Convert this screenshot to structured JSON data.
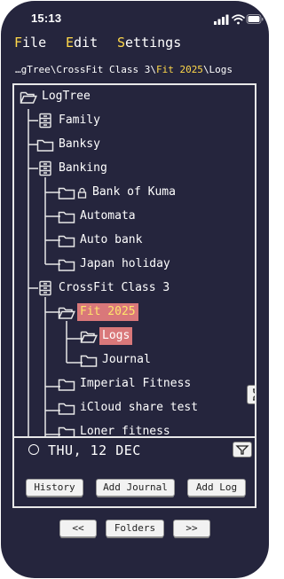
{
  "status": {
    "time": "15:13"
  },
  "menu": {
    "items": [
      {
        "hot": "F",
        "rest": "ile"
      },
      {
        "hot": "E",
        "rest": "dit"
      },
      {
        "hot": "S",
        "rest": "ettings"
      }
    ]
  },
  "breadcrumb": {
    "prefix": "…gTree\\CrossFit Class 3\\",
    "current": "Fit 2025",
    "suffix": "\\Logs"
  },
  "tree": {
    "nodes": [
      {
        "label": "LogTree",
        "depth": 0,
        "icon": "folder-open-icon"
      },
      {
        "label": "Family",
        "depth": 1,
        "icon": "cabinet-icon"
      },
      {
        "label": "Banksy",
        "depth": 1,
        "icon": "folder-icon"
      },
      {
        "label": "Banking",
        "depth": 1,
        "icon": "cabinet-icon"
      },
      {
        "label": "Bank of Kuma",
        "depth": 2,
        "icon": "folder-icon",
        "locked": true
      },
      {
        "label": "Automata",
        "depth": 2,
        "icon": "folder-icon"
      },
      {
        "label": "Auto bank",
        "depth": 2,
        "icon": "folder-icon"
      },
      {
        "label": "Japan holiday",
        "depth": 2,
        "icon": "folder-icon"
      },
      {
        "label": "CrossFit Class 3",
        "depth": 1,
        "icon": "cabinet-icon"
      },
      {
        "label": "Fit 2025",
        "depth": 2,
        "icon": "folder-open-icon",
        "state": "selected-parent"
      },
      {
        "label": "Logs",
        "depth": 3,
        "icon": "folder-open-icon",
        "state": "selected"
      },
      {
        "label": "Journal",
        "depth": 3,
        "icon": "folder-icon"
      },
      {
        "label": "Imperial Fitness",
        "depth": 2,
        "icon": "folder-icon"
      },
      {
        "label": "iCloud share test",
        "depth": 2,
        "icon": "folder-icon"
      },
      {
        "label": "Loner fitness",
        "depth": 2,
        "icon": "folder-icon"
      }
    ]
  },
  "journal": {
    "date": "THU, 12 DEC"
  },
  "actions": {
    "history": "History",
    "add_journal": "Add Journal",
    "add_log": "Add Log"
  },
  "nav": {
    "prev": "<<",
    "folders": "Folders",
    "next": ">>"
  },
  "colors": {
    "background": "#25253d",
    "accent": "#ffd84a",
    "selection": "#d9787a"
  }
}
